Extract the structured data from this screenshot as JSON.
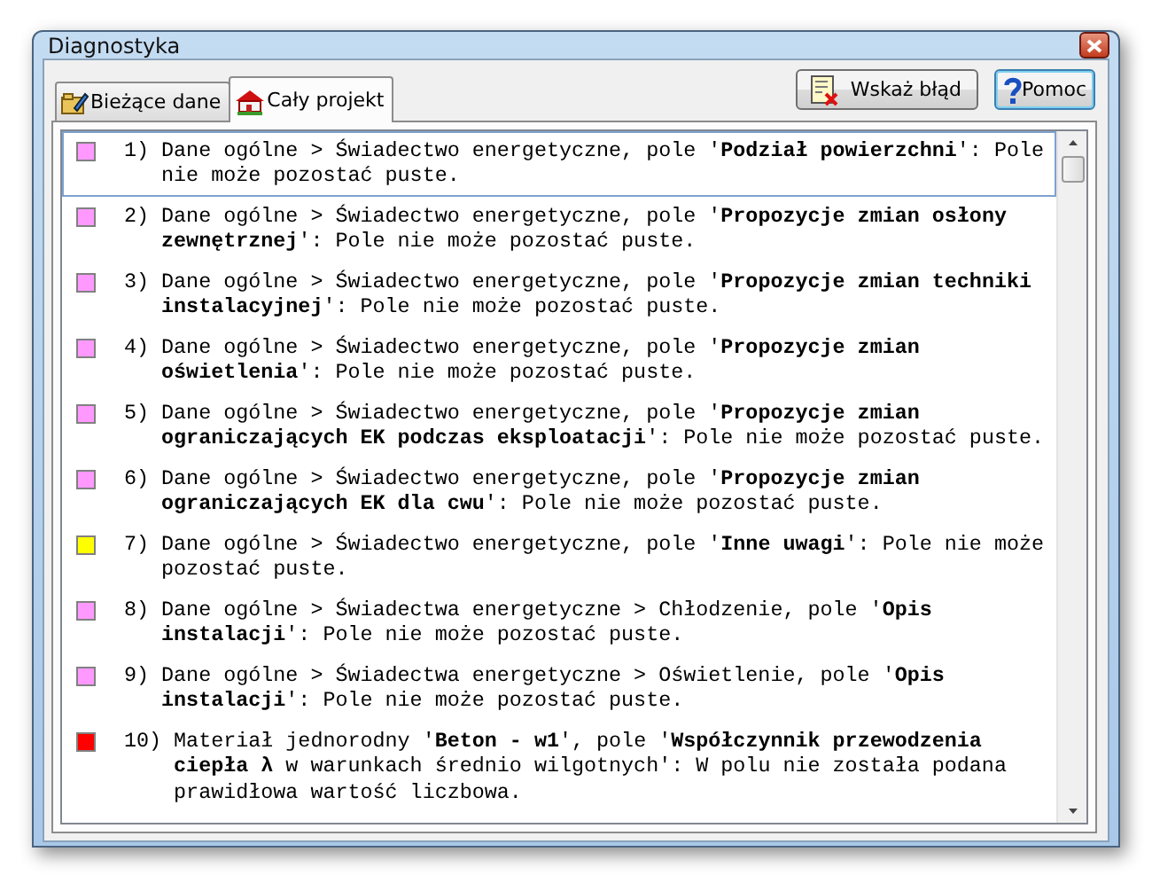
{
  "window": {
    "title": "Diagnostyka"
  },
  "tabs": [
    {
      "label": "Bieżące dane",
      "selected": false,
      "kind": "data"
    },
    {
      "label": "Cały projekt",
      "selected": true,
      "kind": "project"
    }
  ],
  "buttons": [
    {
      "label": "Wskaż błąd",
      "kind": "locate",
      "focused": false
    },
    {
      "label": "Pomoc",
      "kind": "help",
      "focused": true
    }
  ],
  "messages": [
    {
      "number": "1)",
      "text": "Dane ogólne > Świadectwo energetyczne, pole '**Podział powierzchni**': Pole nie może pozostać puste.",
      "color": "#ff99ff",
      "selected": true
    },
    {
      "number": "2)",
      "text": "Dane ogólne > Świadectwo energetyczne, pole '**Propozycje zmian osłony zewnętrznej**': Pole nie może pozostać puste.",
      "color": "#ff99ff",
      "selected": false
    },
    {
      "number": "3)",
      "text": "Dane ogólne > Świadectwo energetyczne, pole '**Propozycje zmian techniki instalacyjnej**': Pole nie może pozostać puste.",
      "color": "#ff99ff",
      "selected": false
    },
    {
      "number": "4)",
      "text": "Dane ogólne > Świadectwo energetyczne, pole '**Propozycje zmian oświetlenia**': Pole nie może pozostać puste.",
      "color": "#ff99ff",
      "selected": false
    },
    {
      "number": "5)",
      "text": "Dane ogólne > Świadectwo energetyczne, pole '**Propozycje zmian ograniczających EK podczas eksploatacji**': Pole nie może pozostać puste.",
      "color": "#ff99ff",
      "selected": false
    },
    {
      "number": "6)",
      "text": "Dane ogólne > Świadectwo energetyczne, pole '**Propozycje zmian ograniczających EK dla cwu**': Pole nie może pozostać puste.",
      "color": "#ff99ff",
      "selected": false
    },
    {
      "number": "7)",
      "text": "Dane ogólne > Świadectwo energetyczne, pole '**Inne uwagi**': Pole nie może pozostać puste.",
      "color": "#ffff00",
      "selected": false
    },
    {
      "number": "8)",
      "text": "Dane ogólne > Świadectwa energetyczne > Chłodzenie, pole '**Opis instalacji**': Pole nie może pozostać puste.",
      "color": "#ff99ff",
      "selected": false
    },
    {
      "number": "9)",
      "text": "Dane ogólne > Świadectwa energetyczne > Oświetlenie, pole '**Opis instalacji**': Pole nie może pozostać puste.",
      "color": "#ff99ff",
      "selected": false
    },
    {
      "number": "10)",
      "text": "Materiał jednorodny '**Beton - w1**', pole '**Współczynnik przewodzenia ciepła λ** w warunkach średnio wilgotnych': W polu nie została podana prawidłowa wartość liczbowa.",
      "color": "#ff0000",
      "selected": false
    }
  ]
}
